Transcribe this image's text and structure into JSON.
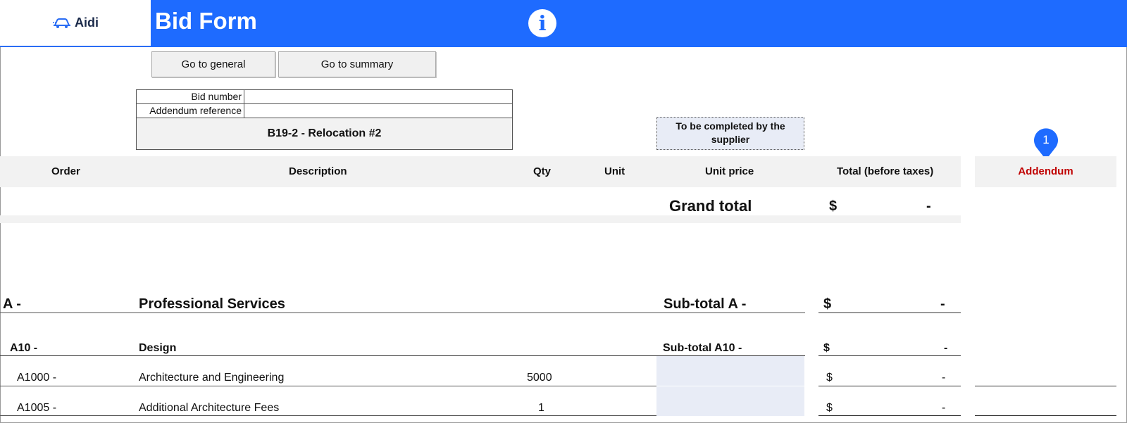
{
  "header": {
    "logo_text": "Aidi",
    "title": "Bid Form",
    "info_icon": "i"
  },
  "buttons": {
    "general": "Go to general",
    "summary": "Go to summary"
  },
  "bid_info": {
    "bid_number_label": "Bid number",
    "bid_number_value": "",
    "addendum_label": "Addendum reference",
    "addendum_value": "",
    "project": "B19-2 - Relocation #2"
  },
  "supplier_note": "To be completed by the supplier",
  "addendum_pin": "1",
  "columns": {
    "order": "Order",
    "description": "Description",
    "qty": "Qty",
    "unit": "Unit",
    "unit_price": "Unit price",
    "total": "Total (before taxes)",
    "addendum": "Addendum"
  },
  "grand_total": {
    "label": "Grand total",
    "currency": "$",
    "value": "-"
  },
  "section_a": {
    "code": "A -",
    "title": "Professional Services",
    "subtotal_label": "Sub-total A -",
    "currency": "$",
    "value": "-"
  },
  "subsection_a10": {
    "code": "A10 -",
    "title": "Design",
    "subtotal_label": "Sub-total A10 -",
    "currency": "$",
    "value": "-"
  },
  "items": [
    {
      "code": "A1000 -",
      "description": "Architecture and Engineering",
      "qty": "5000",
      "unit": "",
      "currency": "$",
      "total": "-"
    },
    {
      "code": "A1005 -",
      "description": "Additional Architecture Fees",
      "qty": "1",
      "unit": "",
      "currency": "$",
      "total": "-"
    }
  ],
  "colors": {
    "header_blue": "#1e6bff",
    "header_band": "#f2f2f2",
    "input_cell": "#e8ecf6",
    "addendum_red": "#c00000"
  }
}
